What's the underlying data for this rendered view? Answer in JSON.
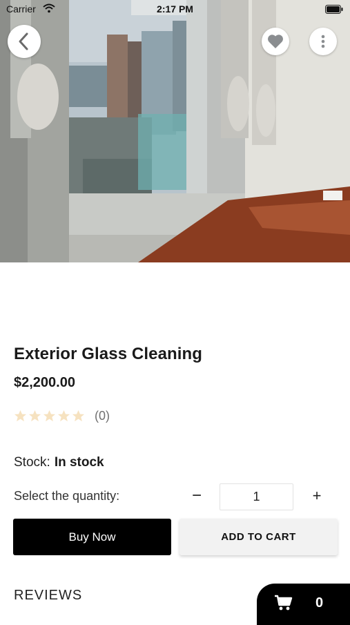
{
  "status_bar": {
    "carrier": "Carrier",
    "time": "2:17 PM"
  },
  "hero_image": {
    "description": "product-photo-window-cleaning",
    "icons": [
      "back-icon",
      "heart-icon",
      "more-vertical-icon"
    ]
  },
  "product": {
    "title": "Exterior Glass Cleaning",
    "price": "$2,200.00",
    "rating_stars": 0,
    "rating_max": 5,
    "review_count": "(0)",
    "stock_label": "Stock:",
    "stock_value": "In stock"
  },
  "quantity": {
    "label": "Select the quantity:",
    "value": "1",
    "minus": "−",
    "plus": "+"
  },
  "actions": {
    "buy_now": "Buy Now",
    "add_to_cart": "ADD TO CART"
  },
  "reviews": {
    "heading": "REVIEWS"
  },
  "cart": {
    "count": "0"
  },
  "colors": {
    "primary": "#000000",
    "secondary_button": "#f2f2f2",
    "star_empty": "#f6e2c0"
  }
}
